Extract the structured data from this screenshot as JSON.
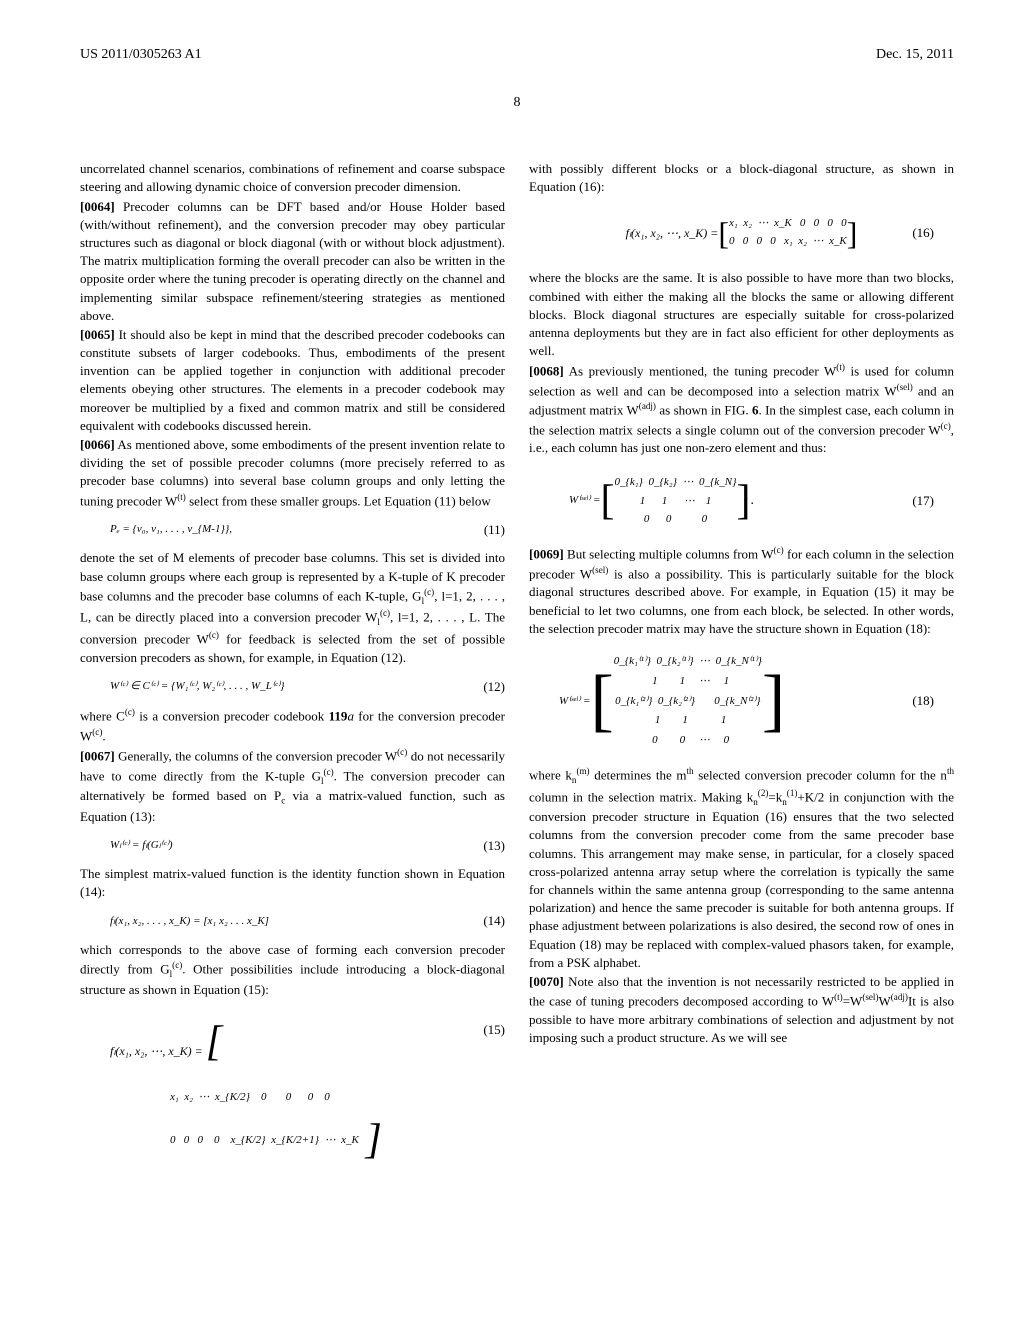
{
  "header": {
    "pub_number": "US 2011/0305263 A1",
    "pub_date": "Dec. 15, 2011"
  },
  "page_number": "8",
  "left_col": {
    "p1": "uncorrelated channel scenarios, combinations of refinement and coarse subspace steering and allowing dynamic choice of conversion precoder dimension.",
    "p2_label": "[0064]",
    "p2": " Precoder columns can be DFT based and/or House Holder based (with/without refinement), and the conversion precoder may obey particular structures such as diagonal or block diagonal (with or without block adjustment). The matrix multiplication forming the overall precoder can also be written in the opposite order where the tuning precoder is operating directly on the channel and implementing similar subspace refinement/steering strategies as mentioned above.",
    "p3_label": "[0065]",
    "p3": " It should also be kept in mind that the described precoder codebooks can constitute subsets of larger codebooks. Thus, embodiments of the present invention can be applied together in conjunction with additional precoder elements obeying other structures. The elements in a precoder codebook may moreover be multiplied by a fixed and common matrix and still be considered equivalent with codebooks discussed herein.",
    "p4_label": "[0066]",
    "p4a": " As mentioned above, some embodiments of the present invention relate to dividing the set of possible precoder columns (more precisely referred to as precoder base columns) into several base column groups and only letting the tuning precoder W",
    "p4_sup": "(t)",
    "p4b": " select from these smaller groups. Let Equation (11) below",
    "eq11": "Pₑ = {v₀, v₁, . . . , v_{M-1}},",
    "eq11_num": "(11)",
    "p5a": "denote the set of M elements of precoder base columns. This set is divided into base column groups where each group is represented by a K-tuple of K precoder base columns and the precoder base columns of each K-tuple, G",
    "p5_sub1": "l",
    "p5_sup1": "(c)",
    "p5b": ", l=1, 2, . . . , L, can be directly placed into a conversion precoder W",
    "p5_sub2": "l",
    "p5_sup2": "(c)",
    "p5c": ", l=1, 2, . . . , L. The conversion precoder W",
    "p5_sup3": "(c)",
    "p5d": " for feedback is selected from the set of possible conversion precoders as shown, for example, in Equation (12).",
    "eq12": "W⁽ᶜ⁾ ∈ C⁽ᶜ⁾ = {W₁⁽ᶜ⁾, W₂⁽ᶜ⁾, . . . , W_L⁽ᶜ⁾}",
    "eq12_num": "(12)",
    "p6a": "where C",
    "p6_sup1": "(c)",
    "p6b": " is a conversion precoder codebook ",
    "p6_bold": "119",
    "p6_italic": "a",
    "p6c": " for the conversion precoder W",
    "p6_sup2": "(c)",
    "p6d": ".",
    "p7_label": "[0067]",
    "p7a": " Generally, the columns of the conversion precoder W",
    "p7_sup1": "(c)",
    "p7b": " do not necessarily have to come directly from the K-tuple G",
    "p7_sub1": "l",
    "p7_sup2": "(c)",
    "p7c": ". The conversion precoder can alternatively be formed based on P",
    "p7_sub2": "c",
    "p7d": " via a matrix-valued function, such as Equation (13):",
    "eq13": "Wₗ⁽ᶜ⁾ = fₗ(Gₗ⁽ᶜ⁾)",
    "eq13_num": "(13)",
    "p8": "The simplest matrix-valued function is the identity function shown in Equation (14):",
    "eq14": "fₗ(x₁, x₂, . . . , x_K) = [x₁ x₂ . . . x_K]",
    "eq14_num": "(14)",
    "p9a": "which corresponds to the above case of forming each conversion precoder directly from G",
    "p9_sub1": "l",
    "p9_sup1": "(c)",
    "p9b": ". Other possibilities include introducing a block-diagonal structure as shown in Equation (15):",
    "eq15_lhs": "fₗ(x₁, x₂, ⋯, x_K) = ",
    "eq15_row1": "x₁  x₂  ⋯  x_{K/2}    0       0      0    0",
    "eq15_row2": "0   0   0    0    x_{K/2}  x_{K/2+1}  ⋯  x_K",
    "eq15_num": "(15)"
  },
  "right_col": {
    "p1": "with possibly different blocks or a block-diagonal structure, as shown in Equation (16):",
    "eq16_lhs": "fₗ(x₁, x₂, ⋯, x_K) = ",
    "eq16_row1": "x₁  x₂  ⋯  x_K   0   0   0   0",
    "eq16_row2": "0   0   0   0   x₁  x₂  ⋯  x_K",
    "eq16_num": "(16)",
    "p2": "where the blocks are the same. It is also possible to have more than two blocks, combined with either the making all the blocks the same or allowing different blocks. Block diagonal structures are especially suitable for cross-polarized antenna deployments but they are in fact also efficient for other deployments as well.",
    "p3_label": "[0068]",
    "p3a": " As previously mentioned, the tuning precoder W",
    "p3_sup1": "(t)",
    "p3b": " is used for column selection as well and can be decomposed into a selection matrix W",
    "p3_sup2": "(sel)",
    "p3c": " and an adjustment matrix W",
    "p3_sup3": "(adj)",
    "p3d": " as shown in FIG. ",
    "p3_fig": "6",
    "p3e": ". In the simplest case, each column in the selection matrix selects a single column out of the conversion precoder W",
    "p3_sup4": "(c)",
    "p3f": ", i.e., each column has just one non-zero element and thus:",
    "eq17_lhs": "W⁽ˢᵉˡ⁾ = ",
    "eq17_row1": "0_{k₁}  0_{k₂}  ⋯  0_{k_N}",
    "eq17_row2": "1      1      ⋯    1",
    "eq17_row3": "0      0           0",
    "eq17_num": "(17)",
    "p4_label": "[0069]",
    "p4a": " But selecting multiple columns from W",
    "p4_sup1": "(c)",
    "p4b": " for each column in the selection precoder W",
    "p4_sup2": "(sel)",
    "p4c": " is also a possibility. This is particularly suitable for the block diagonal structures described above. For example, in Equation (15) it may be beneficial to let two columns, one from each block, be selected. In other words, the selection precoder matrix may have the structure shown in Equation (18):",
    "eq18_lhs": "W⁽ˢᵉˡ⁾ = ",
    "eq18_row1": "0_{k₁⁽¹⁾}  0_{k₂⁽¹⁾}  ⋯  0_{k_N⁽¹⁾}",
    "eq18_row2": "  1        1     ⋯     1",
    "eq18_row3": "0_{k₁⁽²⁾}  0_{k₂⁽²⁾}       0_{k_N⁽²⁾}",
    "eq18_row4": "  1        1            1",
    "eq18_row5": "  0        0     ⋯     0",
    "eq18_num": "(18)",
    "p5a": "where k",
    "p5_sub1": "n",
    "p5_sup1": "(m)",
    "p5b": " determines the m",
    "p5_sup2": "th",
    "p5c": " selected conversion precoder column for the n",
    "p5_sup3": "th",
    "p5d": " column in the selection matrix. Making k",
    "p5_sub2": "n",
    "p5_sup4": "(2)",
    "p5e": "=k",
    "p5_sub3": "n",
    "p5_sup5": "(1)",
    "p5f": "+K/2 in conjunction with the conversion precoder structure in Equation (16) ensures that the two selected columns from the conversion precoder come from the same precoder base columns. This arrangement may make sense, in particular, for a closely spaced cross-polarized antenna array setup where the correlation is typically the same for channels within the same antenna group (corresponding to the same antenna polarization) and hence the same precoder is suitable for both antenna groups. If phase adjustment between polarizations is also desired, the second row of ones in Equation (18) may be replaced with complex-valued phasors taken, for example, from a PSK alphabet.",
    "p6_label": "[0070]",
    "p6a": " Note also that the invention is not necessarily restricted to be applied in the case of tuning precoders decomposed according to W",
    "p6_sup1": "(t)",
    "p6b": "=W",
    "p6_sup2": "(sel)",
    "p6c": "W",
    "p6_sup3": "(adj)",
    "p6d": "It is also possible to have more arbitrary combinations of selection and adjustment by not imposing such a product structure. As we will see"
  }
}
